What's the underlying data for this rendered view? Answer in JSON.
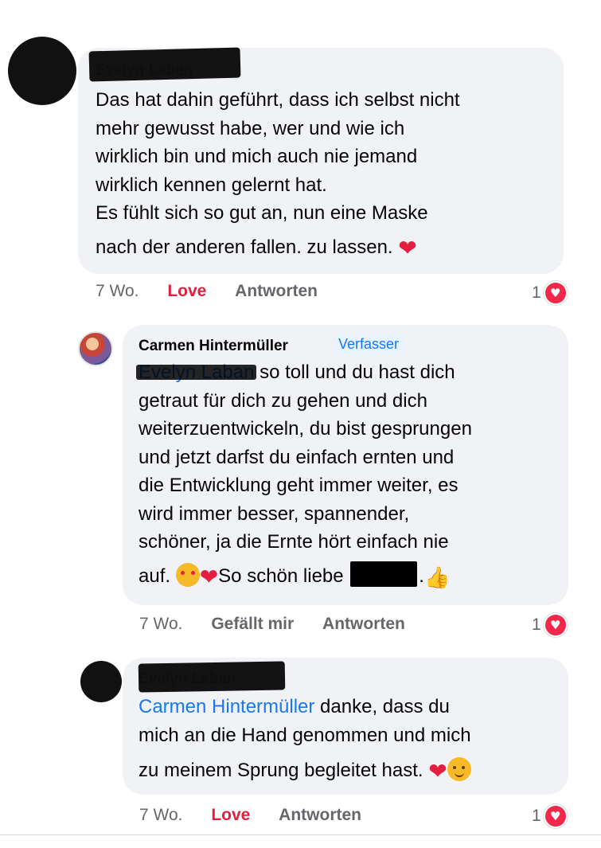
{
  "comments": [
    {
      "author": "Evelyn Laban",
      "lines": [
        "Das hat dahin geführt, dass ich selbst nicht",
        "mehr gewusst habe, wer und wie ich",
        "wirklich bin und mich auch nie jemand",
        "wirklich kennen gelernt hat.",
        "Es fühlt sich so gut an, nun eine Maske",
        "nach der anderen fallen. zu lassen."
      ],
      "time": "7 Wo.",
      "reaction_label": "Love",
      "reply_label": "Antworten",
      "reaction_count": "1"
    },
    {
      "author": "Carmen Hintermüller",
      "badge": "Verfasser",
      "mention": "Evelyn Laban",
      "lines": [
        " so toll und du hast dich",
        "getraut für dich zu gehen und dich",
        "weiterzuentwickeln, du bist gesprungen",
        "und jetzt darfst du einfach ernten und",
        "die Entwicklung geht immer weiter, es",
        "wird immer besser, spannender,",
        "schöner, ja die Ernte hört einfach nie"
      ],
      "last_line_start": "auf. ",
      "last_line_mid": "So schön liebe",
      "last_line_end": ".",
      "time": "7 Wo.",
      "reaction_label": "Gefällt mir",
      "reply_label": "Antworten",
      "reaction_count": "1"
    },
    {
      "author": "Evelyn Laban",
      "mention": "Carmen Hintermüller",
      "lines": [
        " danke, dass du",
        "mich an die Hand genommen und mich",
        "zu meinem Sprung begleitet hast."
      ],
      "time": "7 Wo.",
      "reaction_label": "Love",
      "reply_label": "Antworten",
      "reaction_count": "1"
    }
  ],
  "icons": {
    "heart": "red-heart-emoji",
    "hug": "hugging-face-emoji",
    "love_face": "smiling-face-with-hearts-emoji",
    "thumb": "thumbs-up-emoji",
    "reaction": "love-reaction-icon"
  },
  "colors": {
    "bubble": "#f0f2f5",
    "link": "#1877f2",
    "love": "#e41e3f",
    "meta": "#65676b"
  }
}
